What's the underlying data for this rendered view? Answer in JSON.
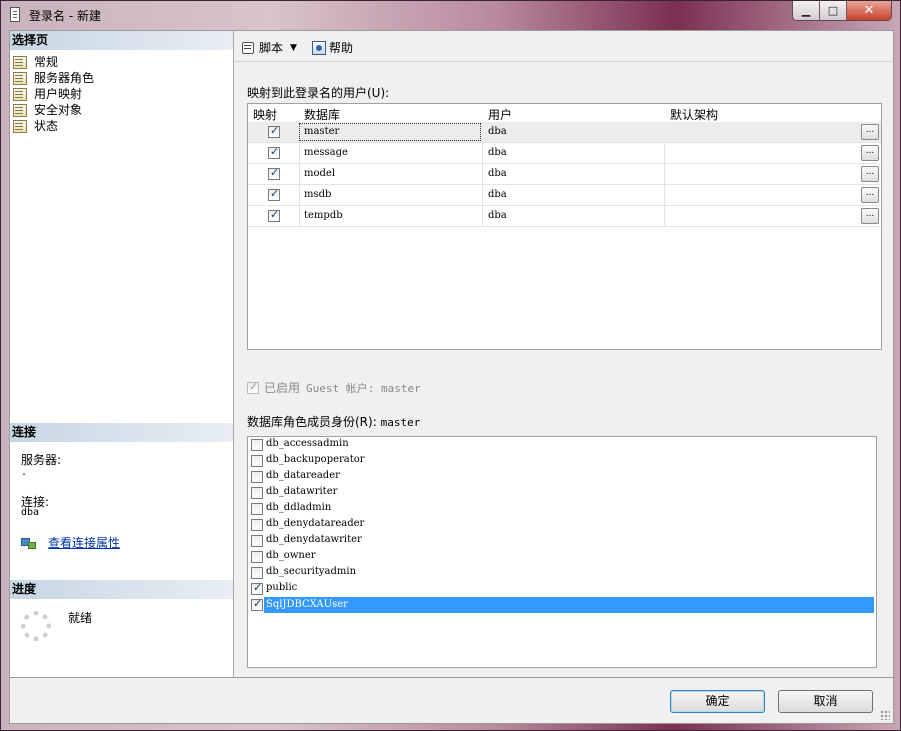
{
  "window": {
    "title": "登录名 - 新建",
    "buttons": {
      "minimize": "▁",
      "maximize": "□",
      "close": "✕"
    }
  },
  "left": {
    "select_page_header": "选择页",
    "pages": [
      {
        "label": "常规"
      },
      {
        "label": "服务器角色"
      },
      {
        "label": "用户映射"
      },
      {
        "label": "安全对象"
      },
      {
        "label": "状态"
      }
    ],
    "connection_header": "连接",
    "server_label": "服务器:",
    "server_value": ".",
    "connection_label": "连接:",
    "connection_value": "dba",
    "view_conn_props": "查看连接属性",
    "progress_header": "进度",
    "progress_status": "就绪"
  },
  "toolbar": {
    "script_label": "脚本",
    "help_label": "帮助"
  },
  "mapping": {
    "label": "映射到此登录名的用户(U):",
    "columns": [
      "映射",
      "数据库",
      "用户",
      "默认架构"
    ],
    "rows": [
      {
        "map": true,
        "database": "master",
        "user": "dba",
        "schema": ""
      },
      {
        "map": true,
        "database": "message",
        "user": "dba",
        "schema": ""
      },
      {
        "map": true,
        "database": "model",
        "user": "dba",
        "schema": ""
      },
      {
        "map": true,
        "database": "msdb",
        "user": "dba",
        "schema": ""
      },
      {
        "map": true,
        "database": "tempdb",
        "user": "dba",
        "schema": ""
      }
    ],
    "ellipsis": "..."
  },
  "guest": {
    "label": "已启用",
    "text": "Guest 帐户: master",
    "checked": true
  },
  "roles": {
    "label": "数据库角色成员身份(R):",
    "db": "master",
    "items": [
      {
        "name": "db_accessadmin",
        "checked": false
      },
      {
        "name": "db_backupoperator",
        "checked": false
      },
      {
        "name": "db_datareader",
        "checked": false
      },
      {
        "name": "db_datawriter",
        "checked": false
      },
      {
        "name": "db_ddladmin",
        "checked": false
      },
      {
        "name": "db_denydatareader",
        "checked": false
      },
      {
        "name": "db_denydatawriter",
        "checked": false
      },
      {
        "name": "db_owner",
        "checked": false
      },
      {
        "name": "db_securityadmin",
        "checked": false
      },
      {
        "name": "public",
        "checked": true
      },
      {
        "name": "SqlJDBCXAUser",
        "checked": true,
        "selected": true
      }
    ]
  },
  "buttons": {
    "ok": "确定",
    "cancel": "取消"
  }
}
